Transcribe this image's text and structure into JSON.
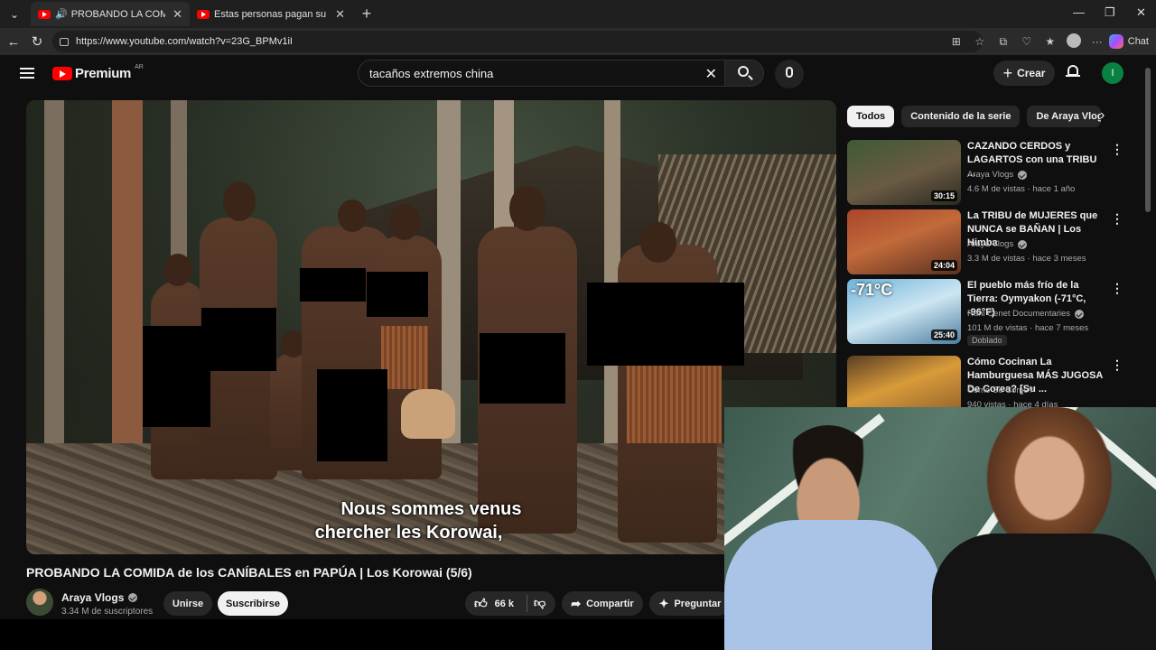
{
  "browser": {
    "tabs": [
      {
        "title": "PROBANDO LA COMIDA de los",
        "active": true
      },
      {
        "title": "Estas personas pagan su vida con",
        "active": false
      }
    ],
    "url": "https://www.youtube.com/watch?v=23G_BPMv1iI",
    "chat_label": "Chat"
  },
  "header": {
    "logo_text": "Premium",
    "country": "AR",
    "search_query": "tacaños extremos china",
    "create_label": "Crear",
    "avatar_letter": "I"
  },
  "video": {
    "subtitle_line1": "Nous sommes venus",
    "subtitle_line2": "chercher les Korowai,",
    "title": "PROBANDO LA COMIDA de los CANÍBALES en PAPÚA | Los Korowai (5/6)",
    "channel": "Araya Vlogs",
    "subscribers": "3.34 M de suscriptores",
    "join_label": "Unirse",
    "subscribe_label": "Suscribirse",
    "likes": "66 k",
    "share_label": "Compartir",
    "ask_label": "Preguntar"
  },
  "chips": [
    "Todos",
    "Contenido de la serie",
    "De Araya Vlogs"
  ],
  "recommendations": [
    {
      "title": "CAZANDO CERDOS y LAGARTOS con una TRIBU ...",
      "channel": "Araya Vlogs",
      "meta": "4.6 M de vistas · hace 1 año",
      "duration": "30:15",
      "badge": ""
    },
    {
      "title": "La TRIBU de MUJERES que NUNCA se BAÑAN | Los Himba",
      "channel": "Araya Vlogs",
      "meta": "3.3 M de vistas · hace 3 meses",
      "duration": "24:04",
      "badge": ""
    },
    {
      "title": "El pueblo más frío de la Tierra: Oymyakon (-71°C, -96°F)",
      "channel": "Ruhi Cenet Documentaries",
      "meta": "101 M de vistas · hace 7 meses",
      "duration": "25:40",
      "badge": "Doblado",
      "thumb_text": "-71°C"
    },
    {
      "title": "Cómo Cocinan La Hamburguesa MÁS JUGOSA De Corea? [Su ...",
      "channel": "Cómo Se Come?",
      "meta": "940 vistas · hace 4 días",
      "duration": "",
      "badge": ""
    }
  ],
  "colors": {
    "background": "#0f0f0f",
    "youtube_red": "#ff0000",
    "chip_active": "#f1f1f1",
    "avatar": "#0b8043"
  }
}
